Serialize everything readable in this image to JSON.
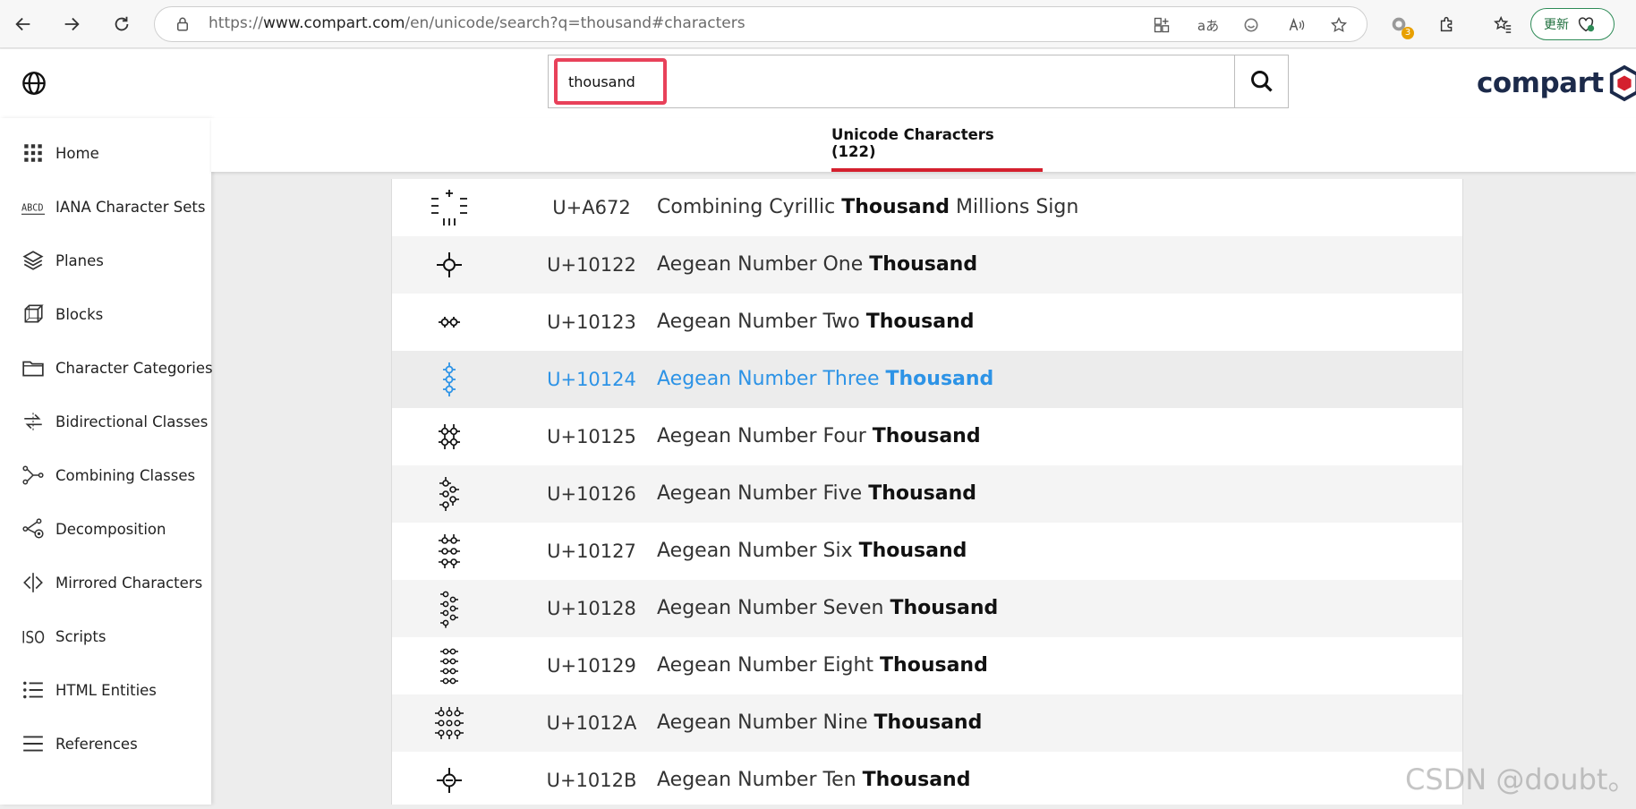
{
  "browser": {
    "url_prefix": "https://",
    "url_host": "www.compart.com",
    "url_path": "/en/unicode/search?q=thousand#characters",
    "ext_badge_count": "3",
    "update_label": "更新",
    "read_aloud_label": "aあ"
  },
  "header": {
    "search_value": "thousand",
    "logo_text": "compart"
  },
  "sidebar": {
    "items": [
      {
        "label": "Home",
        "icon": "grid-icon"
      },
      {
        "label": "IANA Character Sets",
        "icon": "abcd-icon"
      },
      {
        "label": "Planes",
        "icon": "layers-icon"
      },
      {
        "label": "Blocks",
        "icon": "cube-icon"
      },
      {
        "label": "Character Categories",
        "icon": "folder-icon"
      },
      {
        "label": "Bidirectional Classes",
        "icon": "bidi-icon"
      },
      {
        "label": "Combining Classes",
        "icon": "combining-icon"
      },
      {
        "label": "Decomposition",
        "icon": "decomposition-icon"
      },
      {
        "label": "Mirrored Characters",
        "icon": "mirror-icon"
      },
      {
        "label": "Scripts",
        "icon": "iso-icon"
      },
      {
        "label": "HTML Entities",
        "icon": "list-icon"
      },
      {
        "label": "References",
        "icon": "menu-icon"
      }
    ]
  },
  "tabs": {
    "active_label": "Unicode Characters (122)"
  },
  "results": [
    {
      "code": "U+A672",
      "prefix": "Combining Cyrillic ",
      "match": "Thousand",
      "suffix": " Millions Sign",
      "glyph": "cyrillic-millions-sign"
    },
    {
      "code": "U+10122",
      "prefix": "Aegean Number One ",
      "match": "Thousand",
      "suffix": "",
      "glyph": "aegean-1"
    },
    {
      "code": "U+10123",
      "prefix": "Aegean Number Two ",
      "match": "Thousand",
      "suffix": "",
      "glyph": "aegean-2"
    },
    {
      "code": "U+10124",
      "prefix": "Aegean Number Three ",
      "match": "Thousand",
      "suffix": "",
      "glyph": "aegean-3"
    },
    {
      "code": "U+10125",
      "prefix": "Aegean Number Four ",
      "match": "Thousand",
      "suffix": "",
      "glyph": "aegean-4"
    },
    {
      "code": "U+10126",
      "prefix": "Aegean Number Five ",
      "match": "Thousand",
      "suffix": "",
      "glyph": "aegean-5"
    },
    {
      "code": "U+10127",
      "prefix": "Aegean Number Six ",
      "match": "Thousand",
      "suffix": "",
      "glyph": "aegean-6"
    },
    {
      "code": "U+10128",
      "prefix": "Aegean Number Seven ",
      "match": "Thousand",
      "suffix": "",
      "glyph": "aegean-7"
    },
    {
      "code": "U+10129",
      "prefix": "Aegean Number Eight ",
      "match": "Thousand",
      "suffix": "",
      "glyph": "aegean-8"
    },
    {
      "code": "U+1012A",
      "prefix": "Aegean Number Nine ",
      "match": "Thousand",
      "suffix": "",
      "glyph": "aegean-9"
    },
    {
      "code": "U+1012B",
      "prefix": "Aegean Number Ten ",
      "match": "Thousand",
      "suffix": "",
      "glyph": "aegean-10"
    }
  ],
  "watermark": "CSDN @doubt。",
  "colors": {
    "accent_red": "#d4202e",
    "search_highlight": "#e8415a",
    "link_blue": "#2d93e6",
    "logo_navy": "#1c2a4a"
  }
}
